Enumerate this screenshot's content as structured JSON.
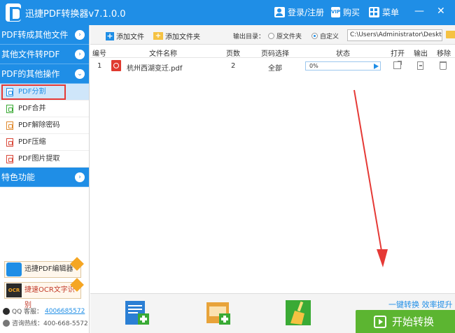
{
  "titlebar": {
    "title": "迅捷PDF转换器v7.1.0.0",
    "login": "登录/注册",
    "buy": "购买",
    "menu": "菜单",
    "minimize": "—",
    "close": "✕"
  },
  "sidebar": {
    "sections": [
      {
        "label": "PDF转成其他文件",
        "chevron": "›"
      },
      {
        "label": "其他文件转PDF",
        "chevron": "›"
      },
      {
        "label": "PDF的其他操作",
        "chevron": "⌄"
      },
      {
        "label": "特色功能",
        "chevron": "›"
      }
    ],
    "items": [
      {
        "label": "PDF分割",
        "color": "#1f8ee6"
      },
      {
        "label": "PDF合并",
        "color": "#3aaa35"
      },
      {
        "label": "PDF解除密码",
        "color": "#e08a2e"
      },
      {
        "label": "PDF压缩",
        "color": "#d9493a"
      },
      {
        "label": "PDF图片提取",
        "color": "#d9493a"
      }
    ],
    "promos": [
      {
        "label": "迅捷PDF编辑器"
      },
      {
        "label": "捷速OCR文字识别",
        "icon_text": "OCR"
      }
    ],
    "qq_label": "QQ 客服：",
    "qq_number": "4006685572",
    "hotline": "咨询热线：400-668-5572"
  },
  "toolbar": {
    "add_file": "添加文件",
    "add_folder": "添加文件夹",
    "output_dir_label": "输出目录：",
    "radio_original": "原文件夹",
    "radio_custom": "自定义",
    "path": "C:\\Users\\Administrator\\Desktop"
  },
  "table": {
    "headers": [
      "编号",
      "文件名称",
      "页数",
      "页码选择",
      "状态",
      "打开",
      "输出",
      "移除"
    ],
    "rows": [
      {
        "index": "1",
        "name": "杭州西湖变迁.pdf",
        "pages": "2",
        "range": "全部",
        "progress_text": "0%",
        "progress": 0
      }
    ]
  },
  "bottom": {
    "slogan": "一键转换  效率提升",
    "start": "开始转换"
  },
  "colors": {
    "brand": "#1f8ee6",
    "start": "#5cb531",
    "highlight": "#e53935"
  }
}
